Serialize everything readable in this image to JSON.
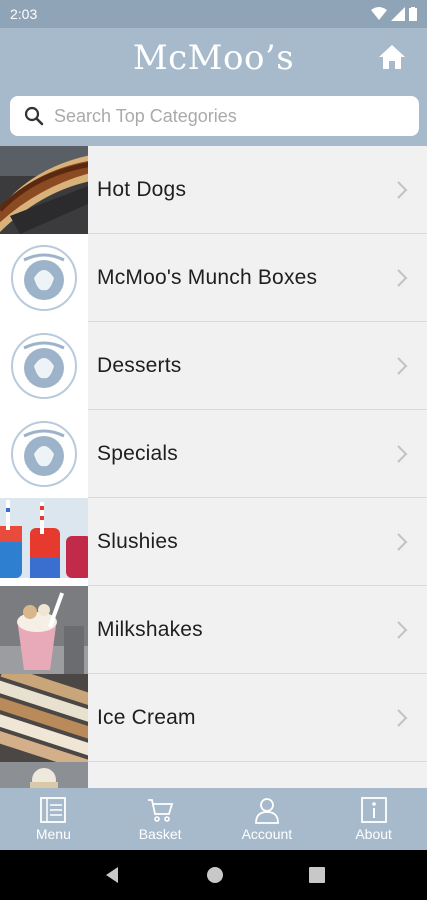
{
  "status": {
    "time": "2:03"
  },
  "header": {
    "brand": "McMoo’s",
    "search_placeholder": "Search Top Categories"
  },
  "categories": [
    {
      "label": "Hot Dogs",
      "thumb": "hot-dog-photo"
    },
    {
      "label": "McMoo's Munch Boxes",
      "thumb": "mcmoos-logo"
    },
    {
      "label": "Desserts",
      "thumb": "mcmoos-logo"
    },
    {
      "label": "Specials",
      "thumb": "mcmoos-logo"
    },
    {
      "label": "Slushies",
      "thumb": "slushies-photo"
    },
    {
      "label": "Milkshakes",
      "thumb": "milkshake-photo"
    },
    {
      "label": "Ice Cream",
      "thumb": "ice-cream-photo"
    },
    {
      "label": "",
      "thumb": "partial-photo"
    }
  ],
  "bottom_nav": [
    {
      "label": "Menu",
      "icon": "menu-icon"
    },
    {
      "label": "Basket",
      "icon": "basket-icon"
    },
    {
      "label": "Account",
      "icon": "account-icon"
    },
    {
      "label": "About",
      "icon": "info-icon"
    }
  ],
  "colors": {
    "header_bg": "#a6bacc",
    "status_bg": "#90a4b8",
    "list_bg": "#f1f1f1",
    "logo_circle": "#9cb3c9"
  }
}
